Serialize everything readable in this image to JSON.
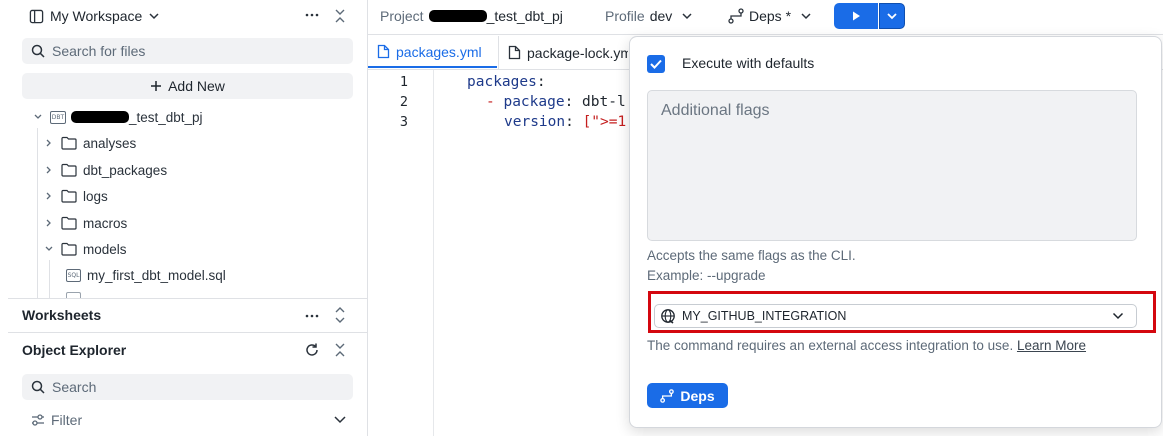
{
  "sidebar": {
    "workspace_label": "My Workspace",
    "search_placeholder": "Search for files",
    "add_new_label": "Add New",
    "project_suffix": "_test_dbt_pj",
    "project_badge": "DBT",
    "tree": [
      {
        "label": "analyses"
      },
      {
        "label": "dbt_packages"
      },
      {
        "label": "logs"
      },
      {
        "label": "macros"
      },
      {
        "label": "models"
      }
    ],
    "model_file": "my_first_dbt_model.sql",
    "model_file_badge": "SQL",
    "worksheets_label": "Worksheets",
    "object_explorer_label": "Object Explorer",
    "object_search_placeholder": "Search",
    "filter_label": "Filter"
  },
  "topbar": {
    "project_label": "Project",
    "project_suffix": "_test_dbt_pj",
    "profile_label": "Profile",
    "profile_value": "dev",
    "deps_label": "Deps *"
  },
  "tabs": [
    {
      "label": "packages.yml"
    },
    {
      "label": "package-lock.yml"
    }
  ],
  "editor": {
    "line_numbers": [
      "1",
      "2",
      "3"
    ],
    "line1_key": "packages",
    "line1_colon": ":",
    "line2_dash": "- ",
    "line2_key": "package",
    "line2_rest": ": dbt-l",
    "line3_key": "version",
    "line3_colon": ": ",
    "line3_val": "[\">=1"
  },
  "popover": {
    "execute_label": "Execute with defaults",
    "flags_placeholder": "Additional flags",
    "hint1": "Accepts the same flags as the CLI.",
    "hint2": "Example: --upgrade",
    "integration_value": "MY_GITHUB_INTEGRATION",
    "note_text": "The command requires an external access integration to use.",
    "learn_more": "Learn More",
    "deps_button": "Deps"
  },
  "colors": {
    "accent": "#1a6ce7",
    "highlight": "#d4070f"
  }
}
